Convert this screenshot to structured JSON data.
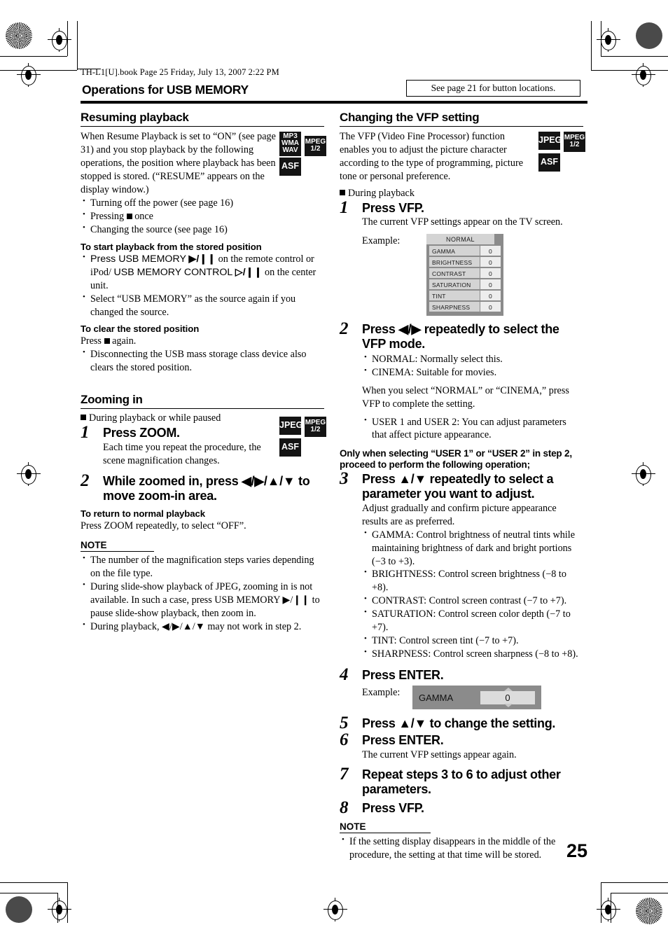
{
  "printer": {
    "file_header": "TH-L1[U].book  Page 25  Friday, July 13, 2007  2:22 PM"
  },
  "banner": {
    "title": "Operations for USB MEMORY",
    "see_page_note": "See page 21 for button locations."
  },
  "page_number": "25",
  "left_column": {
    "section1": {
      "heading": "Resuming playback",
      "intro": "When Resume Playback is set to “ON” (see page 31) and you stop playback by the following operations, the position where playback has been stopped is stored. (“RESUME” appears on the display window.)",
      "bullets": [
        "Turning off the power (see page 16)",
        "Changing the source (see page 16)"
      ],
      "bullet_stop_prefix": "Pressing",
      "bullet_stop_suffix": "once",
      "badges": [
        {
          "lines": [
            "MP3",
            "WMA",
            "WAV"
          ]
        },
        {
          "lines": [
            "MPEG",
            "1/2"
          ]
        },
        {
          "lines": [
            "ASF"
          ]
        }
      ],
      "sub1_heading": "To start playback from the stored position",
      "sub1_bullet1_a": "Press USB MEMORY",
      "sub1_bullet1_glyph1": "▶/❙❙",
      "sub1_bullet1_b": "on the remote control or iPod/",
      "sub1_bullet1_c": "USB MEMORY CONTROL",
      "sub1_bullet1_glyph2": "▷/❙❙",
      "sub1_bullet1_d": "on the center unit.",
      "sub1_bullet2": "Select “USB MEMORY” as the source again if you changed the source.",
      "sub2_heading": "To clear the stored position",
      "sub2_press_prefix": "Press",
      "sub2_press_suffix": "again.",
      "sub2_bullet1": "Disconnecting the USB mass storage class device also clears the stored position."
    },
    "section2": {
      "heading": "Zooming in",
      "context": "During playback or while paused",
      "badges": [
        {
          "lines": [
            "JPEG"
          ]
        },
        {
          "lines": [
            "MPEG",
            "1/2"
          ]
        },
        {
          "lines": [
            "ASF"
          ]
        }
      ],
      "steps": [
        {
          "num": "1",
          "title": "Press ZOOM.",
          "body": "Each time you repeat the procedure, the scene magnification changes."
        },
        {
          "num": "2",
          "title": "While zoomed in, press ◀/▶/▲/▼ to move zoom-in area."
        }
      ],
      "sub1_heading": "To return to normal playback",
      "sub1_body": "Press ZOOM repeatedly, to select “OFF”.",
      "note_heading": "NOTE",
      "notes": [
        "The number of the magnification steps varies depending on the file type.",
        "During slide-show playback of JPEG, zooming in is not available. In such a case, press USB MEMORY ▶/❙❙ to pause slide-show playback, then zoom in.",
        "During playback, ◀/▶/▲/▼ may not work in step 2."
      ]
    }
  },
  "right_column": {
    "section1": {
      "heading": "Changing the VFP setting",
      "intro": "The VFP (Video Fine Processor) function enables you to adjust the picture character according to the type of programming, picture tone or personal preference.",
      "badges": [
        {
          "lines": [
            "JPEG"
          ]
        },
        {
          "lines": [
            "MPEG",
            "1/2"
          ]
        },
        {
          "lines": [
            "ASF"
          ]
        }
      ],
      "context": "During playback",
      "steps": [
        {
          "num": "1",
          "title": "Press VFP.",
          "body": "The current VFP settings appear on the TV screen."
        },
        {
          "num": "2",
          "title": "Press ◀/▶ repeatedly to select the VFP mode.",
          "bullets": [
            "NORMAL: Normally select this.",
            "CINEMA: Suitable for movies."
          ],
          "para": "When you select “NORMAL” or “CINEMA,” press VFP to complete the setting.",
          "bullets2": [
            "USER 1 and USER 2: You can adjust parameters that affect picture appearance."
          ]
        },
        {
          "num": "3",
          "title": "Press ▲/▼ repeatedly to select a parameter you want to adjust.",
          "body": "Adjust gradually and confirm picture appearance results are as preferred.",
          "bullets": [
            "GAMMA: Control brightness of neutral tints while maintaining brightness of dark and bright portions (−3 to +3).",
            "BRIGHTNESS: Control screen brightness (−8 to +8).",
            "CONTRAST: Control screen contrast (−7 to +7).",
            "SATURATION: Control screen color depth (−7 to +7).",
            "TINT: Control screen tint (−7 to +7).",
            "SHARPNESS: Control screen sharpness (−8 to +8)."
          ]
        },
        {
          "num": "4",
          "title": "Press ENTER."
        },
        {
          "num": "5",
          "title": "Press ▲/▼ to change the setting."
        },
        {
          "num": "6",
          "title": "Press ENTER.",
          "body": "The current VFP settings appear again."
        },
        {
          "num": "7",
          "title": "Repeat steps 3 to 6 to adjust other parameters."
        },
        {
          "num": "8",
          "title": "Press VFP."
        }
      ],
      "only_when_note": "Only when selecting “USER 1” or “USER 2” in step 2, proceed to perform the following operation;",
      "example_label_1": "Example:",
      "example_label_2": "Example:",
      "osd_vfp": {
        "title": "NORMAL",
        "rows": [
          {
            "name": "GAMMA",
            "value": "0"
          },
          {
            "name": "BRIGHTNESS",
            "value": "0"
          },
          {
            "name": "CONTRAST",
            "value": "0"
          },
          {
            "name": "SATURATION",
            "value": "0"
          },
          {
            "name": "TINT",
            "value": "0"
          },
          {
            "name": "SHARPNESS",
            "value": "0"
          }
        ]
      },
      "osd_gamma": {
        "name": "GAMMA",
        "value": "0"
      },
      "note_heading": "NOTE",
      "notes": [
        "If the setting display disappears in the middle of the procedure, the setting at that time will be stored."
      ]
    }
  }
}
